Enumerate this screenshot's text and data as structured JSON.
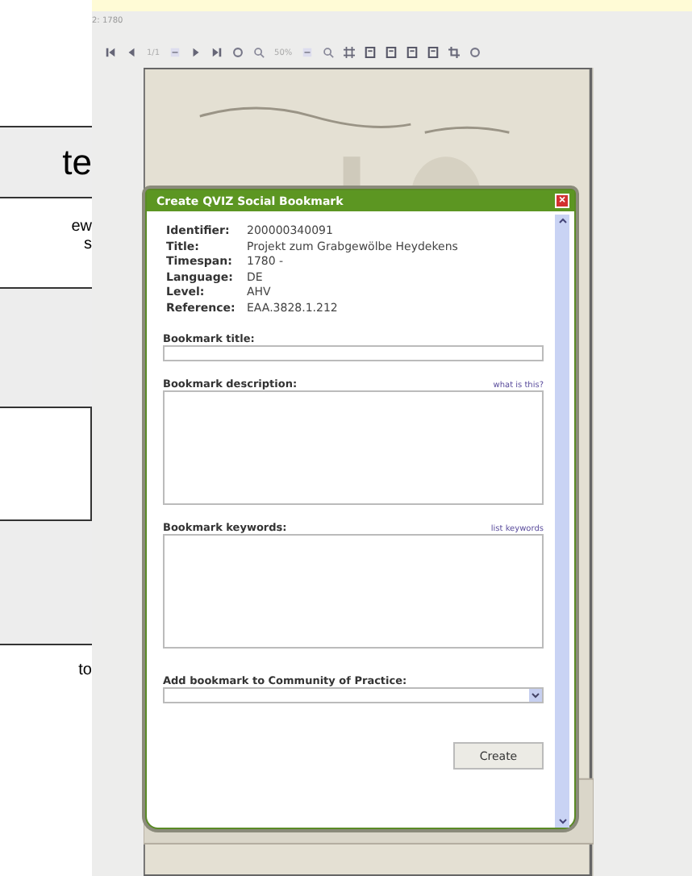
{
  "left_panel": {
    "fragments": [
      "te",
      "ew",
      "s",
      "to"
    ]
  },
  "viewer": {
    "caption": "2: 1780",
    "toolbar": [
      {
        "kind": "first"
      },
      {
        "kind": "prev"
      },
      {
        "kind": "text",
        "label": "1/1"
      },
      {
        "kind": "minus"
      },
      {
        "kind": "next"
      },
      {
        "kind": "last"
      },
      {
        "kind": "circle"
      },
      {
        "kind": "zoom"
      },
      {
        "kind": "text",
        "label": "50%"
      },
      {
        "kind": "minus"
      },
      {
        "kind": "zoom"
      },
      {
        "kind": "fit"
      },
      {
        "kind": "page"
      },
      {
        "kind": "page"
      },
      {
        "kind": "page"
      },
      {
        "kind": "page"
      },
      {
        "kind": "crop"
      },
      {
        "kind": "circle"
      }
    ]
  },
  "dialog": {
    "title": "Create QVIZ Social Bookmark",
    "close": "×",
    "metadata": [
      {
        "label": "Identifier:",
        "value": "200000340091"
      },
      {
        "label": "Title:",
        "value": "Projekt zum Grabgewölbe Heydekens"
      },
      {
        "label": "Timespan:",
        "value": "1780 -"
      },
      {
        "label": "Language:",
        "value": "DE"
      },
      {
        "label": "Level:",
        "value": "AHV"
      },
      {
        "label": "Reference:",
        "value": "EAA.3828.1.212"
      }
    ],
    "fields": [
      {
        "kind": "input",
        "label": "Bookmark title:"
      },
      {
        "kind": "textarea",
        "label": "Bookmark description:",
        "link": "what is this?"
      },
      {
        "kind": "textarea",
        "label": "Bookmark keywords:",
        "link": "list keywords"
      },
      {
        "kind": "select",
        "label": "Add bookmark to Community of Practice:"
      }
    ],
    "button": "Create"
  }
}
